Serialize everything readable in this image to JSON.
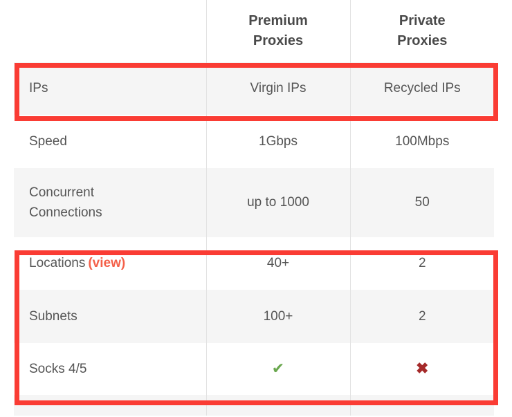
{
  "table": {
    "columns": [
      {
        "id": "feature",
        "label": ""
      },
      {
        "id": "premium",
        "line1": "Premium",
        "line2": "Proxies"
      },
      {
        "id": "private",
        "line1": "Private",
        "line2": "Proxies"
      }
    ],
    "rows": [
      {
        "feature": "IPs",
        "link": "",
        "premium": "Virgin IPs",
        "private": "Recycled IPs",
        "shaded": true,
        "highlighted": true
      },
      {
        "feature": "Speed",
        "link": "",
        "premium": "1Gbps",
        "private": "100Mbps",
        "shaded": false,
        "highlighted": false
      },
      {
        "feature": "Concurrent Connections",
        "feature_line1": "Concurrent",
        "feature_line2": "Connections",
        "link": "",
        "premium": "up to 1000",
        "private": "50",
        "shaded": true,
        "highlighted": false
      },
      {
        "feature": "Locations",
        "link": "(view)",
        "premium": "40+",
        "private": "2",
        "shaded": false,
        "highlighted": true
      },
      {
        "feature": "Subnets",
        "link": "",
        "premium": "100+",
        "private": "2",
        "shaded": true,
        "highlighted": true
      },
      {
        "feature": "Socks 4/5",
        "link": "",
        "premium": "check-icon",
        "private": "cross-icon",
        "premium_glyph": "✔",
        "private_glyph": "✖",
        "shaded": false,
        "highlighted": true
      }
    ]
  },
  "colors": {
    "highlight_box": "#fa3c34",
    "link": "#f4614a",
    "check": "#6aa84f",
    "cross": "#a52a2a",
    "row_shaded": "#f5f5f5",
    "row_plain": "#ffffff",
    "divider": "#e2e2e2",
    "header_text": "#4a4a4a",
    "body_text": "#555555"
  }
}
